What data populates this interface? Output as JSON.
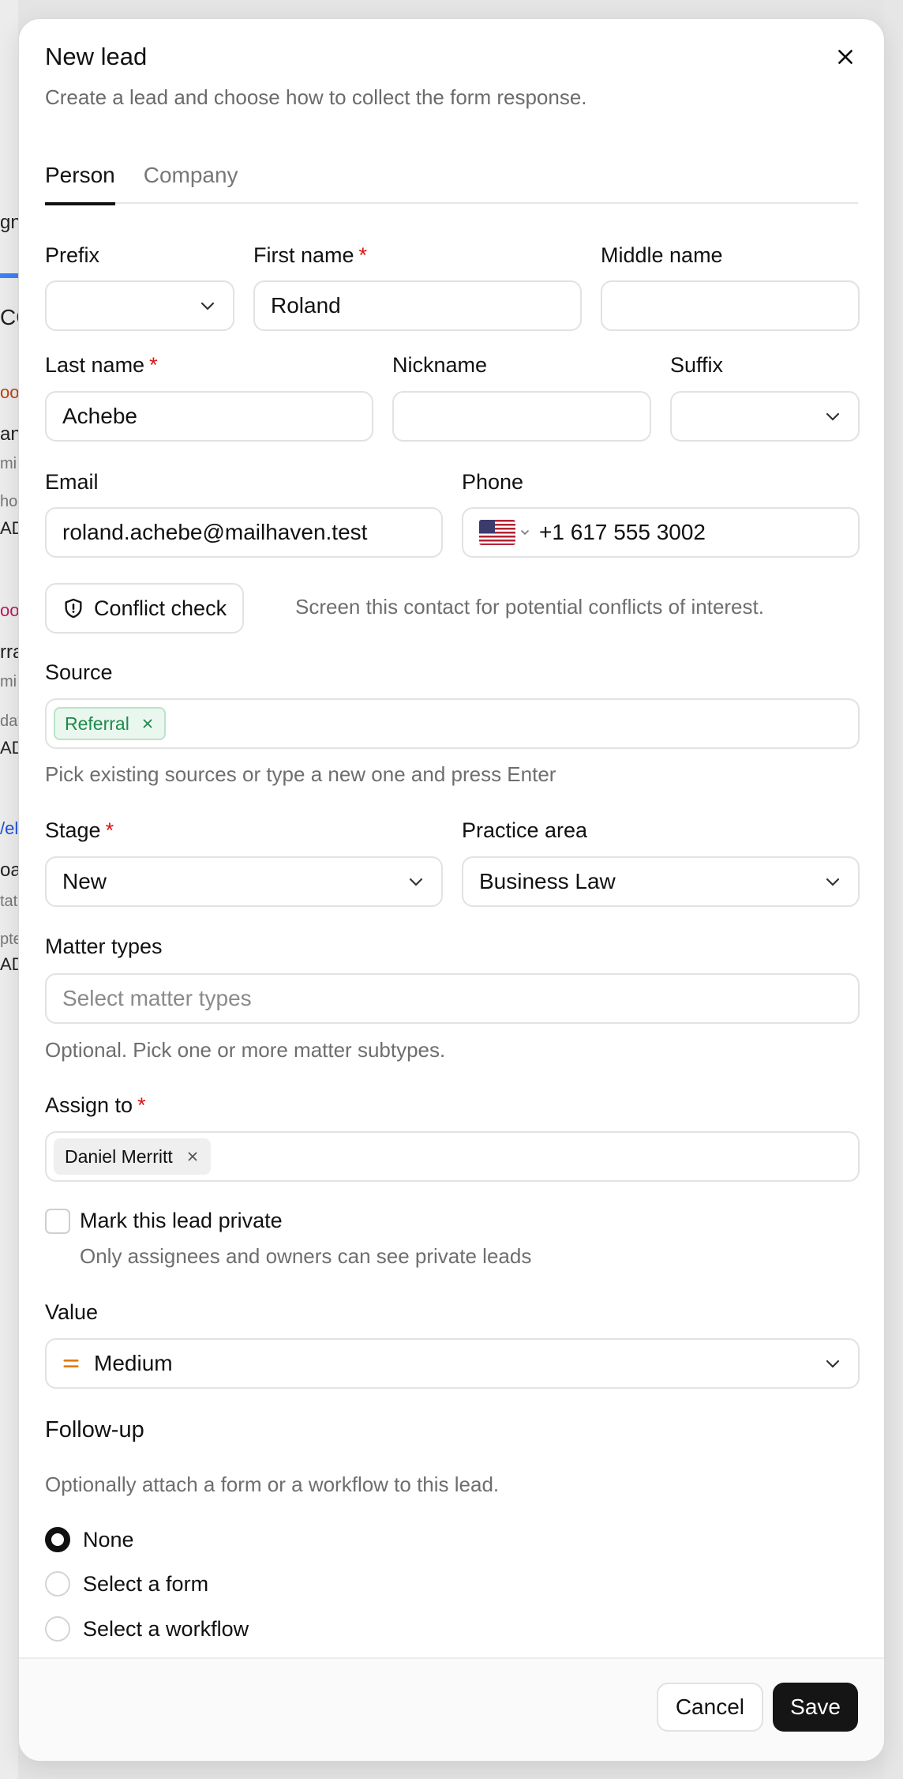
{
  "background": {
    "fragments": [
      "gne",
      "CO",
      "ooc",
      "an",
      "mi",
      "hoi",
      "AD",
      "ooc",
      "rra",
      "mi",
      "day",
      "AD",
      "/el",
      "oar",
      "tat",
      "pte",
      "AD"
    ]
  },
  "modal": {
    "title": "New lead",
    "subtitle": "Create a lead and choose how to collect the form response.",
    "tabs": [
      {
        "label": "Person",
        "active": true
      },
      {
        "label": "Company",
        "active": false
      }
    ]
  },
  "form": {
    "prefix": {
      "label": "Prefix",
      "value": ""
    },
    "first_name": {
      "label": "First name",
      "value": "Roland",
      "required": "*"
    },
    "middle_name": {
      "label": "Middle name",
      "value": ""
    },
    "last_name": {
      "label": "Last name",
      "value": "Achebe",
      "required": "*"
    },
    "nickname": {
      "label": "Nickname",
      "value": ""
    },
    "suffix": {
      "label": "Suffix",
      "value": ""
    },
    "email": {
      "label": "Email",
      "value": "roland.achebe@mailhaven.test"
    },
    "phone": {
      "label": "Phone",
      "value": "+1 617 555 3002",
      "country_icon": "us-flag-icon"
    },
    "conflict_check": {
      "label": "Conflict check",
      "description": "Screen this contact for potential conflicts of interest."
    },
    "source": {
      "label": "Source",
      "chips": [
        "Referral"
      ],
      "help": "Pick existing sources or type a new one and press Enter"
    },
    "stage": {
      "label": "Stage",
      "value": "New",
      "required": "*"
    },
    "practice_area": {
      "label": "Practice area",
      "value": "Business Law"
    },
    "matter_types": {
      "label": "Matter types",
      "placeholder": "Select matter types",
      "help": "Optional. Pick one or more matter subtypes."
    },
    "assign_to": {
      "label": "Assign to",
      "required": "*",
      "chips": [
        "Daniel Merritt"
      ]
    },
    "private": {
      "label": "Mark this lead private",
      "help": "Only assignees and owners can see private leads",
      "checked": false
    },
    "value": {
      "label": "Value",
      "selected": "Medium",
      "icon_color": "#e07b00"
    }
  },
  "follow_up": {
    "title": "Follow-up",
    "description": "Optionally attach a form or a workflow to this lead.",
    "options": [
      {
        "label": "None",
        "selected": true
      },
      {
        "label": "Select a form",
        "selected": false
      },
      {
        "label": "Select a workflow",
        "selected": false
      }
    ]
  },
  "footer": {
    "cancel_label": "Cancel",
    "save_label": "Save"
  },
  "colors": {
    "accent": "#151515",
    "required": "#dd1111",
    "source_chip_bg": "#e9f7ee",
    "source_chip_text": "#1f8a4c"
  }
}
